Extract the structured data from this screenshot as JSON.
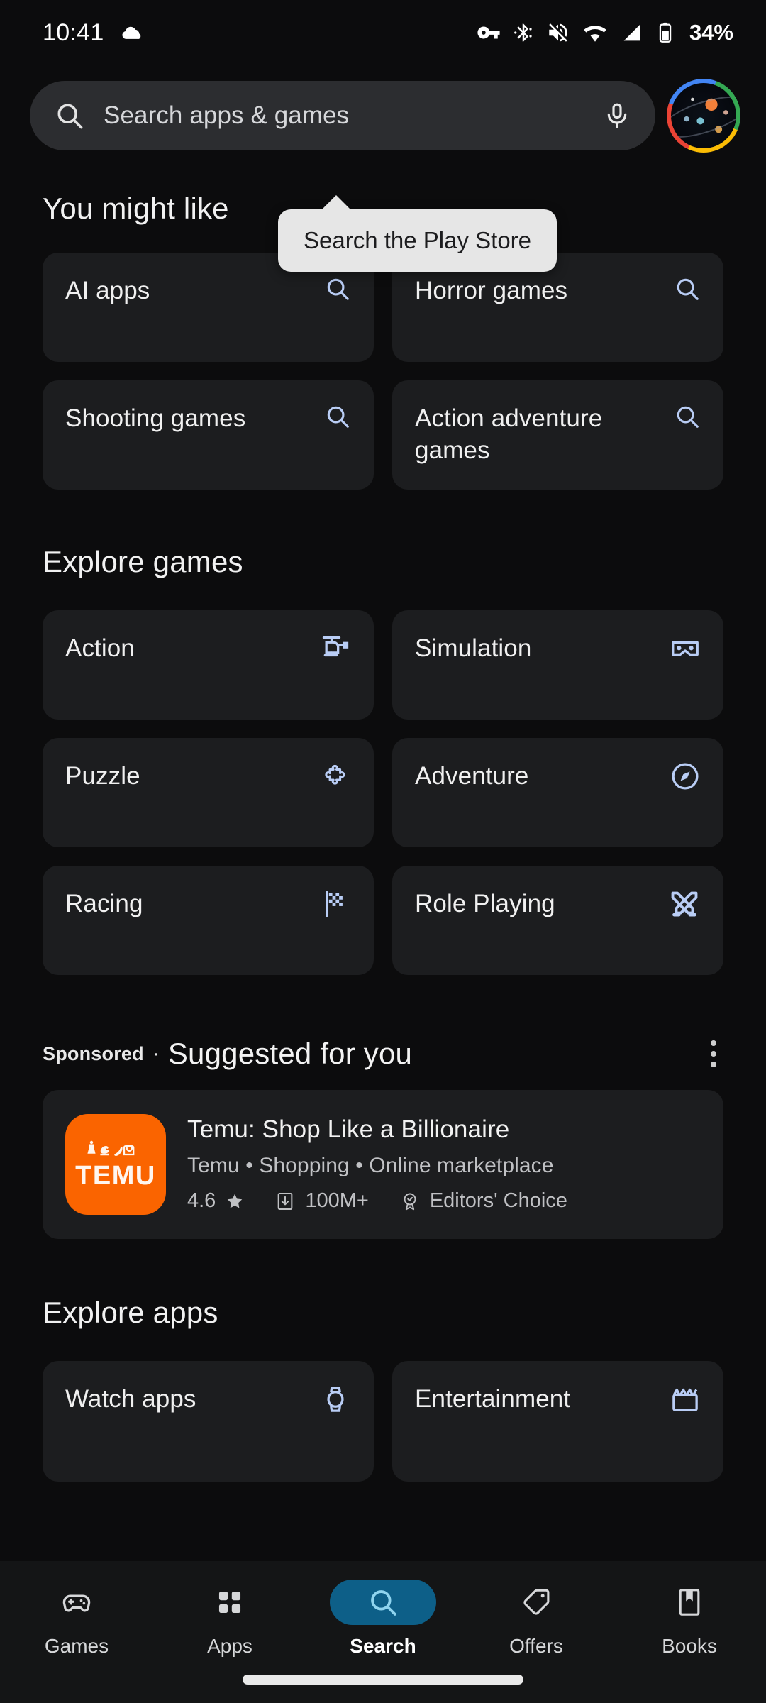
{
  "status_bar": {
    "time": "10:41",
    "battery_percent": "34%",
    "icons": [
      "cloud-icon",
      "vpn-key-icon",
      "bluetooth-icon",
      "volume-off-icon",
      "wifi-icon",
      "signal-icon",
      "battery-icon"
    ]
  },
  "search": {
    "placeholder": "Search apps & games",
    "search_icon": "search-icon",
    "mic_icon": "microphone-icon",
    "avatar": "account-avatar"
  },
  "tooltip": {
    "text": "Search the Play Store"
  },
  "you_might_like": {
    "title": "You might like",
    "items": [
      {
        "label": "AI apps",
        "icon": "search-icon"
      },
      {
        "label": "Horror games",
        "icon": "search-icon"
      },
      {
        "label": "Shooting games",
        "icon": "search-icon"
      },
      {
        "label": "Action adventure games",
        "icon": "search-icon"
      }
    ]
  },
  "explore_games": {
    "title": "Explore games",
    "items": [
      {
        "label": "Action",
        "icon": "helicopter-icon"
      },
      {
        "label": "Simulation",
        "icon": "vr-goggles-icon"
      },
      {
        "label": "Puzzle",
        "icon": "puzzle-piece-icon"
      },
      {
        "label": "Adventure",
        "icon": "compass-icon"
      },
      {
        "label": "Racing",
        "icon": "checkered-flag-icon"
      },
      {
        "label": "Role Playing",
        "icon": "crossed-swords-icon"
      }
    ]
  },
  "sponsored": {
    "tag": "Sponsored",
    "separator": "·",
    "title": "Suggested for you",
    "overflow_icon": "more-vert-icon",
    "app": {
      "icon_text": "TEMU",
      "icon_color": "#fa6400",
      "title": "Temu: Shop Like a Billionaire",
      "subtitle": "Temu • Shopping • Online marketplace",
      "rating": "4.6",
      "star_icon": "star-icon",
      "download_icon": "download-icon",
      "downloads": "100M+",
      "badge_icon": "editors-choice-icon",
      "badge": "Editors' Choice"
    }
  },
  "explore_apps": {
    "title": "Explore apps",
    "items": [
      {
        "label": "Watch apps",
        "icon": "smartwatch-icon"
      },
      {
        "label": "Entertainment",
        "icon": "clapperboard-icon"
      }
    ]
  },
  "bottom_nav": {
    "active": "Search",
    "items": [
      {
        "label": "Games",
        "icon": "gamepad-icon"
      },
      {
        "label": "Apps",
        "icon": "grid-apps-icon"
      },
      {
        "label": "Search",
        "icon": "search-icon"
      },
      {
        "label": "Offers",
        "icon": "tag-icon"
      },
      {
        "label": "Books",
        "icon": "book-bookmark-icon"
      }
    ]
  },
  "colors": {
    "background": "#0c0c0d",
    "card": "#1c1d1f",
    "accent_icon": "#b9cdf5",
    "nav_active_pill": "#0d5f88",
    "tooltip_bg": "#e6e6e6"
  }
}
